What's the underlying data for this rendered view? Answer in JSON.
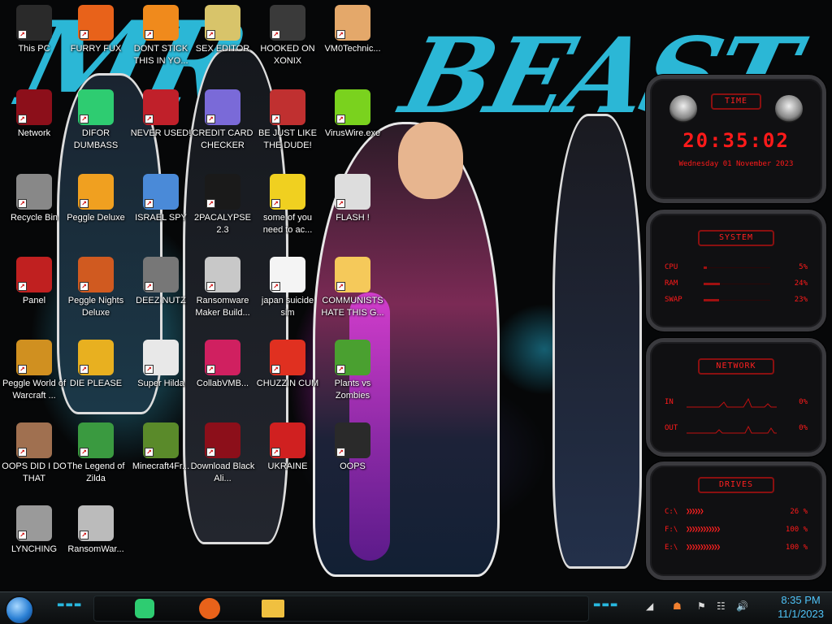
{
  "desktop_icons": [
    {
      "label": "This PC",
      "icon": "computer-icon",
      "color": "#2a2a2a"
    },
    {
      "label": "FURRY FUX",
      "icon": "firefox-icon",
      "color": "#e8621a"
    },
    {
      "label": "DONT STICK THIS IN YO...",
      "icon": "vlc-cone-icon",
      "color": "#f08a1c"
    },
    {
      "label": "SEX EDITOR",
      "icon": "hex-editor-icon",
      "color": "#d8c46a"
    },
    {
      "label": "HOOKED ON XONIX",
      "icon": "xonix-game-icon",
      "color": "#3a3a3a"
    },
    {
      "label": "VM0Technic...",
      "icon": "doctor-icon",
      "color": "#e4a86a"
    },
    {
      "label": "Network",
      "icon": "network-icon",
      "color": "#8c0f1a"
    },
    {
      "label": "DIFOR DUMBASS",
      "icon": "spotify-like-icon",
      "color": "#2ecc71"
    },
    {
      "label": "NEVER USED!",
      "icon": "dev-icon",
      "color": "#c0202a"
    },
    {
      "label": "CREDIT CARD CHECKER",
      "icon": "credit-card-icon",
      "color": "#7a6ad8"
    },
    {
      "label": "BE JUST LIKE THE DUDE!",
      "icon": "santa-icon",
      "color": "#c03030"
    },
    {
      "label": "VirusWire.exe",
      "icon": "lime-icon",
      "color": "#7ad21e"
    },
    {
      "label": "Recycle Bin",
      "icon": "recycle-bin-icon",
      "color": "#888888"
    },
    {
      "label": "Peggle Deluxe",
      "icon": "peggle-icon",
      "color": "#f0a020"
    },
    {
      "label": "ISRAEL SPY",
      "icon": "spy-icon",
      "color": "#4a8ad8"
    },
    {
      "label": "2PACALYPSE 2.3",
      "icon": "terminal-icon",
      "color": "#1a1a1a"
    },
    {
      "label": "some of you need to ac...",
      "icon": "beaver-icon",
      "color": "#f0d020"
    },
    {
      "label": "FLASH !",
      "icon": "flash-icon",
      "color": "#dddddd"
    },
    {
      "label": "Panel",
      "icon": "control-panel-icon",
      "color": "#c02020"
    },
    {
      "label": "Peggle Nights Deluxe",
      "icon": "peggle-icon",
      "color": "#d05a20"
    },
    {
      "label": "DEEZ NUTZ",
      "icon": "windows-stack-icon",
      "color": "#777777"
    },
    {
      "label": "Ransomware Maker Build...",
      "icon": "ransomware-window-icon",
      "color": "#c8c8c8"
    },
    {
      "label": "japan suicide sim",
      "icon": "document-icon",
      "color": "#f4f4f4"
    },
    {
      "label": "COMMUNISTS HATE THIS G...",
      "icon": "star-butterfly-icon",
      "color": "#f5c95a"
    },
    {
      "label": "Peggle World of Warcraft ...",
      "icon": "peggle-icon",
      "color": "#d09020"
    },
    {
      "label": "DIE PLEASE",
      "icon": "de-icon",
      "color": "#e8b020"
    },
    {
      "label": "Super Hilda",
      "icon": "pixel-art-icon",
      "color": "#e8e8e8"
    },
    {
      "label": "CollabVMB...",
      "icon": "collabvm-icon",
      "color": "#d02060"
    },
    {
      "label": "CHUZZIN CUM",
      "icon": "chuzzle-icon",
      "color": "#e03020"
    },
    {
      "label": "Plants vs Zombies",
      "icon": "plants-vs-zombies-icon",
      "color": "#4aa030"
    },
    {
      "label": "OOPS DID I DO THAT",
      "icon": "portrait-icon",
      "color": "#a07050"
    },
    {
      "label": "The Legend of Zilda",
      "icon": "zelda-icon",
      "color": "#3a9a40"
    },
    {
      "label": "Minecraft4Fr...",
      "icon": "minecraft-block-icon",
      "color": "#5a8a2a"
    },
    {
      "label": "Download Black Ali...",
      "icon": "network-icon",
      "color": "#8c0f1a"
    },
    {
      "label": "UKRAINE",
      "icon": "radiation-icon",
      "color": "#d02020"
    },
    {
      "label": "OOPS",
      "icon": "dark-window-icon",
      "color": "#2a2a2a"
    },
    {
      "label": "LYNCHING",
      "icon": "noose-icon",
      "color": "#9a9a9a"
    },
    {
      "label": "RansomWar...",
      "icon": "skull-icon",
      "color": "#bbbbbb"
    }
  ],
  "wallpaper": {
    "title_left": "MR",
    "title_right": "BEAST"
  },
  "widgets": {
    "time": {
      "heading": "TIME",
      "clock": "20:35:02",
      "date": "Wednesday 01 November 2023"
    },
    "system": {
      "heading": "SYSTEM",
      "rows": [
        {
          "key": "CPU",
          "value": "5%",
          "fill": 0.05
        },
        {
          "key": "RAM",
          "value": "24%",
          "fill": 0.24
        },
        {
          "key": "SWAP",
          "value": "23%",
          "fill": 0.23
        }
      ]
    },
    "network": {
      "heading": "NETWORK",
      "rows": [
        {
          "key": "IN",
          "value": "0%"
        },
        {
          "key": "OUT",
          "value": "0%"
        }
      ]
    },
    "drives": {
      "heading": "DRIVES",
      "rows": [
        {
          "key": "C:\\",
          "value": "26 %"
        },
        {
          "key": "F:\\",
          "value": "100 %"
        },
        {
          "key": "E:\\",
          "value": "100 %"
        }
      ]
    }
  },
  "taskbar": {
    "apps": [
      {
        "name": "spotify-like-icon",
        "color": "#2ecc71"
      },
      {
        "name": "firefox-icon",
        "color": "#e8621a"
      },
      {
        "name": "file-explorer-icon",
        "color": "#f0c040"
      }
    ],
    "clock_time": "8:35 PM",
    "clock_date": "11/1/2023",
    "accent": "#4fc3f7"
  }
}
